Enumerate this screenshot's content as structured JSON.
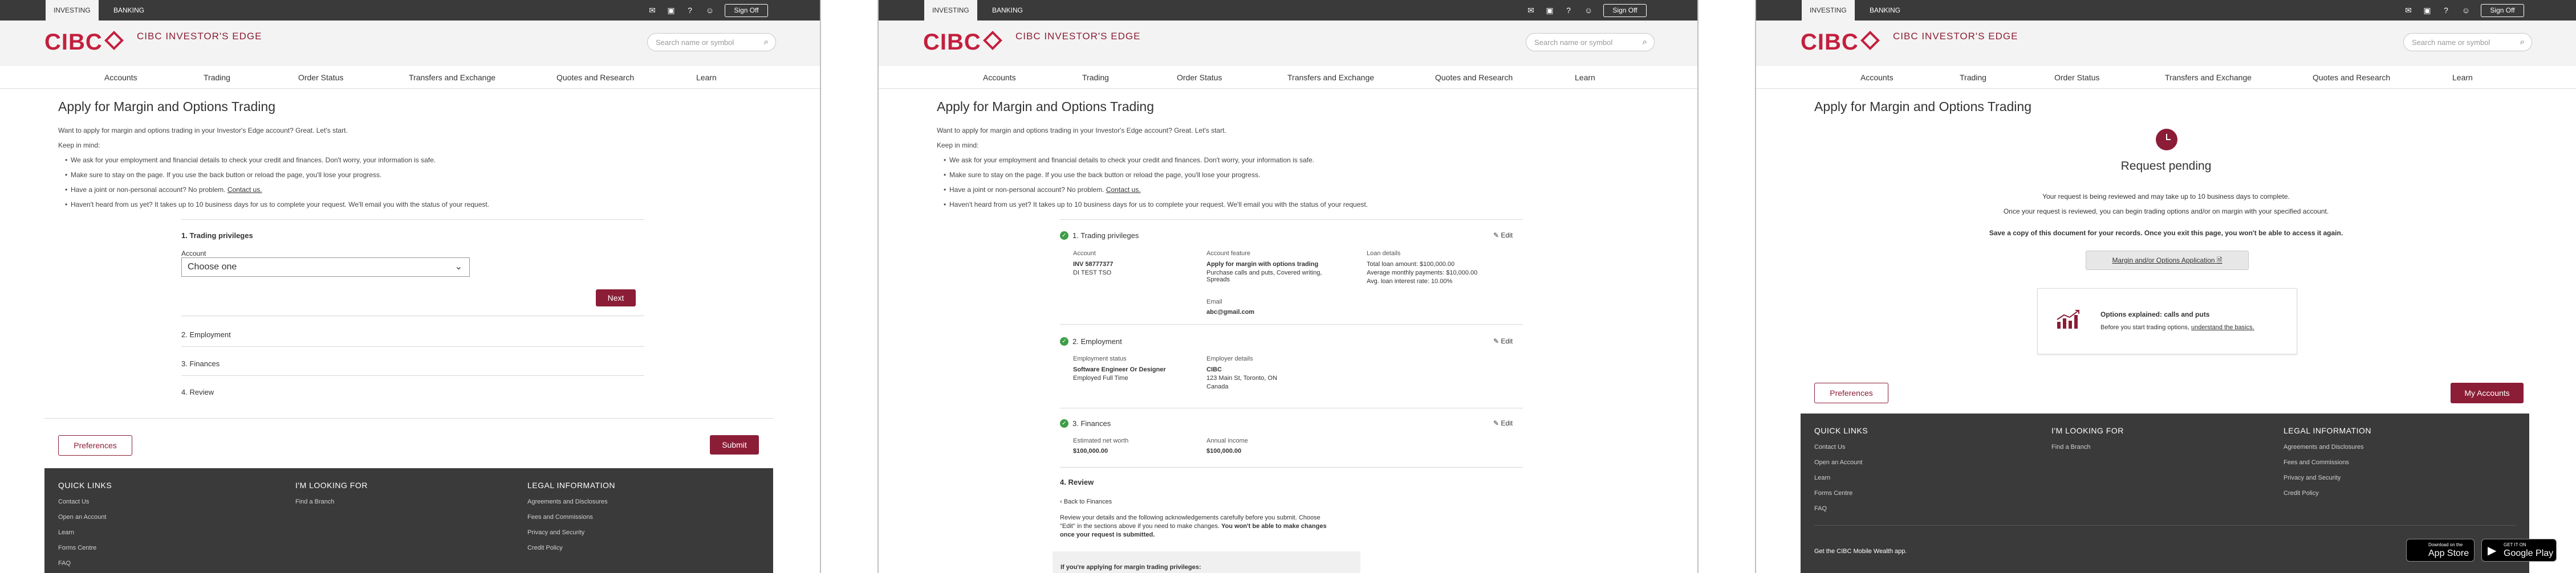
{
  "screens": [
    {
      "topbar": {
        "tab_investing": "INVESTING",
        "tab_banking": "BANKING",
        "sign_off": "Sign Off"
      },
      "header": {
        "logo": "CIBC",
        "brand": "CIBC INVESTOR'S EDGE",
        "search_placeholder": "Search name or symbol"
      },
      "nav": [
        "Accounts",
        "Trading",
        "Order Status",
        "Transfers and Exchange",
        "Quotes and Research",
        "Learn"
      ],
      "page_title": "Apply for Margin and Options Trading",
      "intro": "Want to apply for margin and options trading in your Investor's Edge account? Great. Let's start.",
      "keep_in_mind": "Keep in mind:",
      "bullets": [
        "We ask for your employment and financial details to check your credit and finances. Don't worry, your information is safe.",
        "Make sure to stay on the page. If you use the back button or reload the page, you'll lose your progress.",
        "Have a joint or non-personal account? No problem.",
        "Haven't heard from us yet? It takes up to 10 business days for us to complete your request. We'll email you with the status of your request."
      ],
      "contact_us": "Contact us.",
      "steps": {
        "step1": "1. Trading privileges",
        "account_label": "Account",
        "account_select": "Choose one",
        "next": "Next",
        "step2": "2. Employment",
        "step3": "3. Finances",
        "step4": "4. Review"
      },
      "actions": {
        "preferences": "Preferences",
        "submit": "Submit"
      },
      "footer": {
        "quick_links": "QUICK LINKS",
        "quick_items": [
          "Contact Us",
          "Open an Account",
          "Learn",
          "Forms Centre",
          "FAQ"
        ],
        "looking_for": "I'M LOOKING FOR",
        "looking_items": [
          "Find a Branch"
        ],
        "legal": "LEGAL INFORMATION",
        "legal_items": [
          "Agreements and Disclosures",
          "Fees and Commissions",
          "Privacy and Security",
          "Credit Policy"
        ]
      }
    },
    {
      "review": {
        "s1_title": "1. Trading privileges",
        "edit": "Edit",
        "account_label": "Account",
        "account_number": "INV 58777377",
        "account_name": "DI TEST TSO",
        "feature_label": "Account feature",
        "feature_value": "Apply for margin with options trading",
        "feature_desc": "Purchase calls and puts, Covered writing, Spreads",
        "loan_label": "Loan details",
        "loan_1": "Total loan amount: $100,000.00",
        "loan_2": "Average monthly payments: $10,000.00",
        "loan_3": "Avg. loan interest rate: 10.00%",
        "email_label": "Email",
        "email_value": "abc@gmail.com",
        "s2_title": "2. Employment",
        "emp_status_label": "Employment status",
        "emp_status_value": "Software Engineer Or Designer",
        "emp_status_sub": "Employed Full Time",
        "emp_details_label": "Employer details",
        "emp_name": "CIBC",
        "emp_addr1": "123 Main St, Toronto, ON",
        "emp_addr2": "Canada",
        "s3_title": "3. Finances",
        "net_worth_label": "Estimated net worth",
        "net_worth_value": "$100,000.00",
        "income_label": "Annual income",
        "income_value": "$100,000.00",
        "s4_title": "4. Review",
        "back_link": "Back to Finances",
        "review_text_1": "Review your details and the following acknowledgements carefully before you submit. Choose",
        "review_text_2": "\"Edit\" in the sections above if you need to make changes.",
        "review_text_bold_2": "You won't be able to make changes",
        "review_text_bold_3": "once your request is submitted.",
        "margin_heading": "If you're applying for margin trading privileges:"
      }
    },
    {
      "pending": {
        "title": "Request pending",
        "line1": "Your request is being reviewed and may take up to 10 business days to complete.",
        "line2": "Once your request is reviewed, you can begin trading options and/or on margin with your specified account.",
        "line3": "Save a copy of this document for your records. Once you exit this page, you won't be able to access it again.",
        "pdf_button": "Margin and/or Options Application",
        "card_title": "Options explained: calls and puts",
        "card_text": "Before you start trading options,",
        "card_link": "understand the basics.",
        "preferences": "Preferences",
        "my_accounts": "My Accounts",
        "app_text": "Get the CIBC Mobile Wealth app.",
        "app_store_small": "Download on the",
        "app_store_big": "App Store",
        "google_small": "GET IT ON",
        "google_big": "Google Play"
      }
    }
  ],
  "colors": {
    "brand_red": "#c41f3e",
    "maroon": "#8b1d36",
    "dark_bar": "#3a3a3a",
    "success_green": "#3e9e47"
  }
}
